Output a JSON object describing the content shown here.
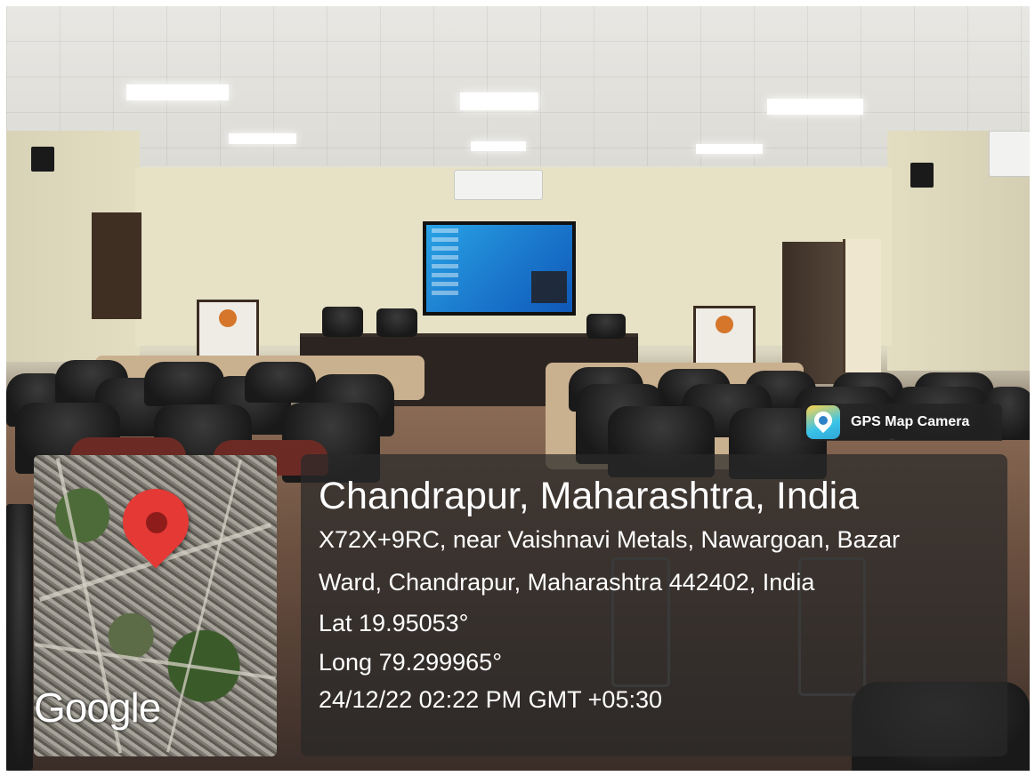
{
  "gps_badge": {
    "label": "GPS Map Camera",
    "icon": "gps-map-camera-app-icon"
  },
  "location": {
    "title": "Chandrapur, Maharashtra, India",
    "address_line1": "X72X+9RC, near Vaishnavi Metals, Nawargoan, Bazar",
    "address_line2": "Ward, Chandrapur, Maharashtra 442402, India",
    "latitude": "Lat 19.95053°",
    "longitude": "Long 79.299965°",
    "datetime": "24/12/22 02:22 PM GMT +05:30"
  },
  "map": {
    "attribution": "Google",
    "pin_icon": "map-pin-icon",
    "pin_color": "#e53935"
  },
  "colors": {
    "overlay": "#282828",
    "text": "#ffffff"
  }
}
